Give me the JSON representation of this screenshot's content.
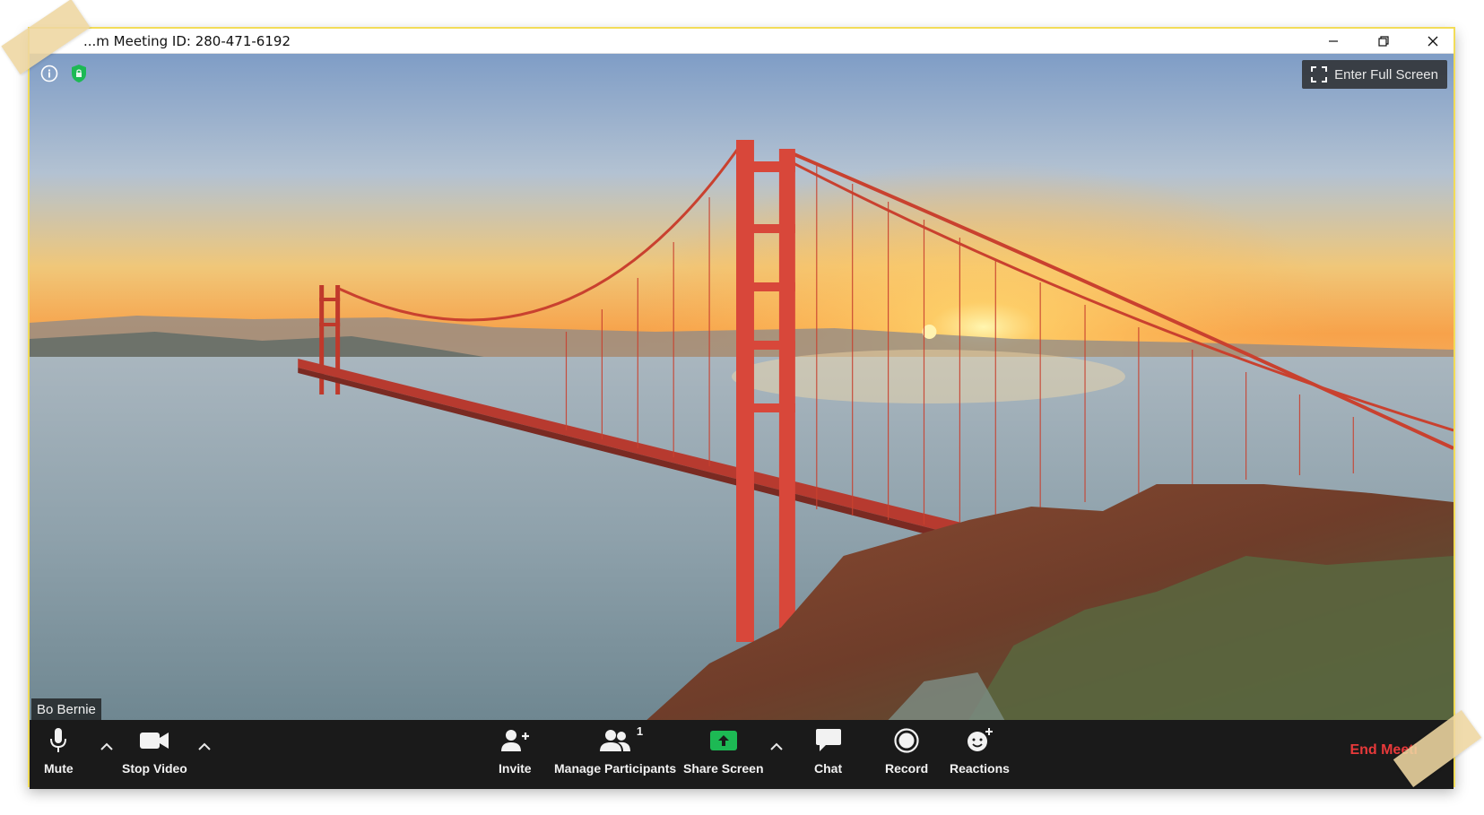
{
  "window": {
    "title": "...m Meeting ID: 280-471-6192"
  },
  "video": {
    "fullscreen_label": "Enter Full Screen",
    "participant_name": "Bo Bernie"
  },
  "toolbar": {
    "mute_label": "Mute",
    "stop_video_label": "Stop Video",
    "invite_label": "Invite",
    "participants_label": "Manage Participants",
    "participants_count": "1",
    "share_label": "Share Screen",
    "chat_label": "Chat",
    "record_label": "Record",
    "reactions_label": "Reactions",
    "end_label": "End Meeti"
  },
  "colors": {
    "accent_green": "#1db954",
    "end_red": "#e8393a",
    "toolbar_bg": "#1a1a1a",
    "window_border": "#f2dc58"
  }
}
